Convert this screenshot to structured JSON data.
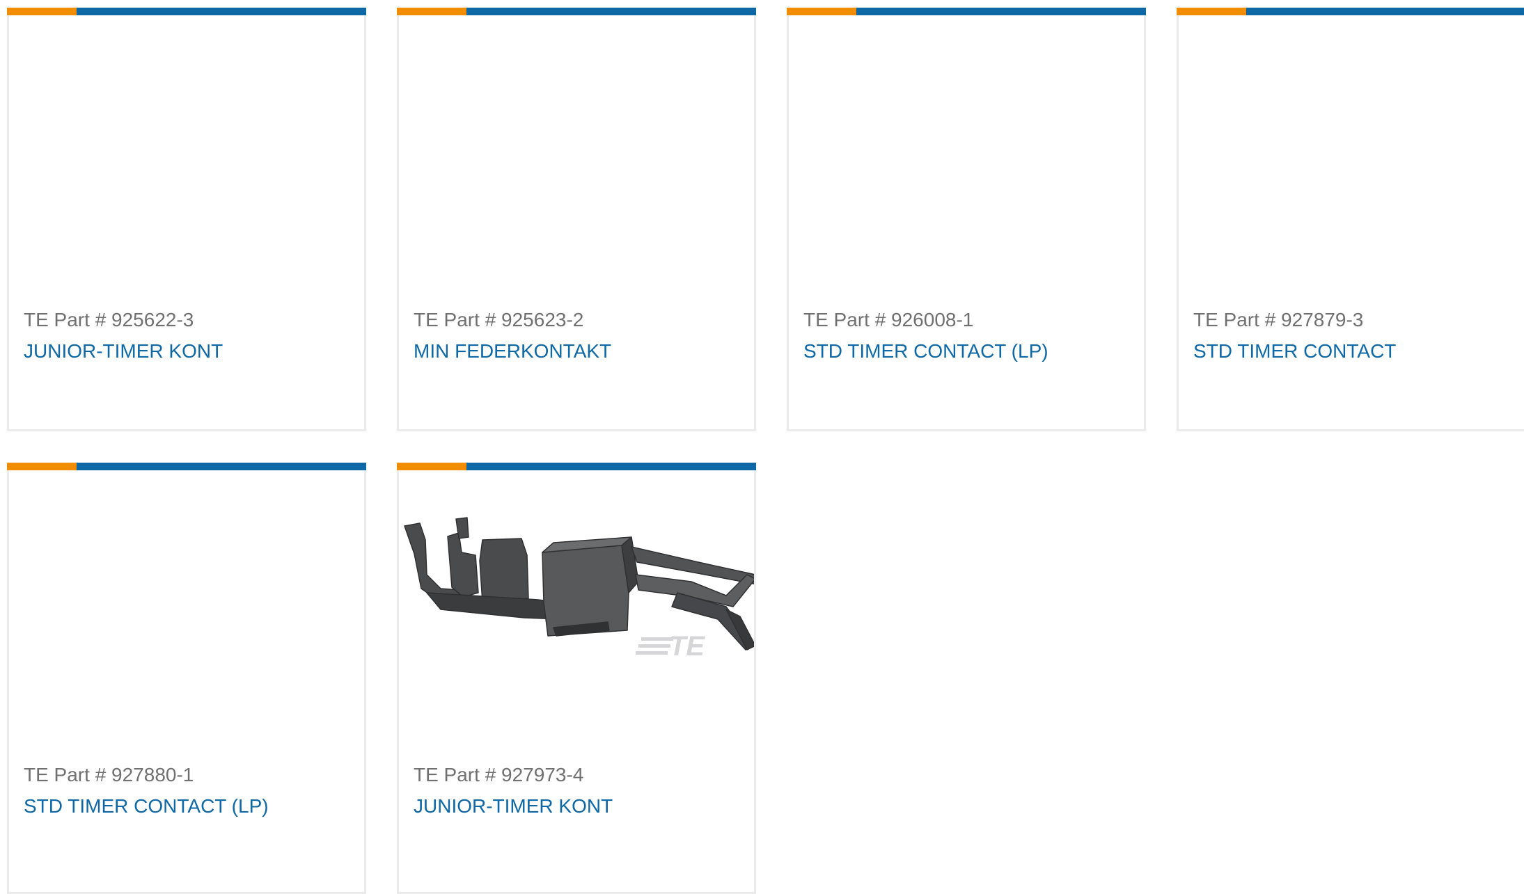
{
  "colors": {
    "accent_orange": "#f28d00",
    "accent_blue": "#0d68a5",
    "part_number_text": "#707070",
    "card_border": "#ebebeb"
  },
  "cards": [
    {
      "part_number": "TE Part # 925622-3",
      "name": "JUNIOR-TIMER KONT",
      "has_image": false
    },
    {
      "part_number": "TE Part # 925623-2",
      "name": "MIN FEDERKONTAKT",
      "has_image": false
    },
    {
      "part_number": "TE Part # 926008-1",
      "name": "STD TIMER CONTACT (LP)",
      "has_image": false
    },
    {
      "part_number": "TE Part # 927879-3",
      "name": "STD TIMER CONTACT",
      "has_image": false
    },
    {
      "part_number": "TE Part # 927880-1",
      "name": "STD TIMER CONTACT (LP)",
      "has_image": false
    },
    {
      "part_number": "TE Part # 927973-4",
      "name": "JUNIOR-TIMER KONT",
      "has_image": true,
      "image_icon": "timer-contact-terminal-icon",
      "watermark": "TE"
    }
  ]
}
